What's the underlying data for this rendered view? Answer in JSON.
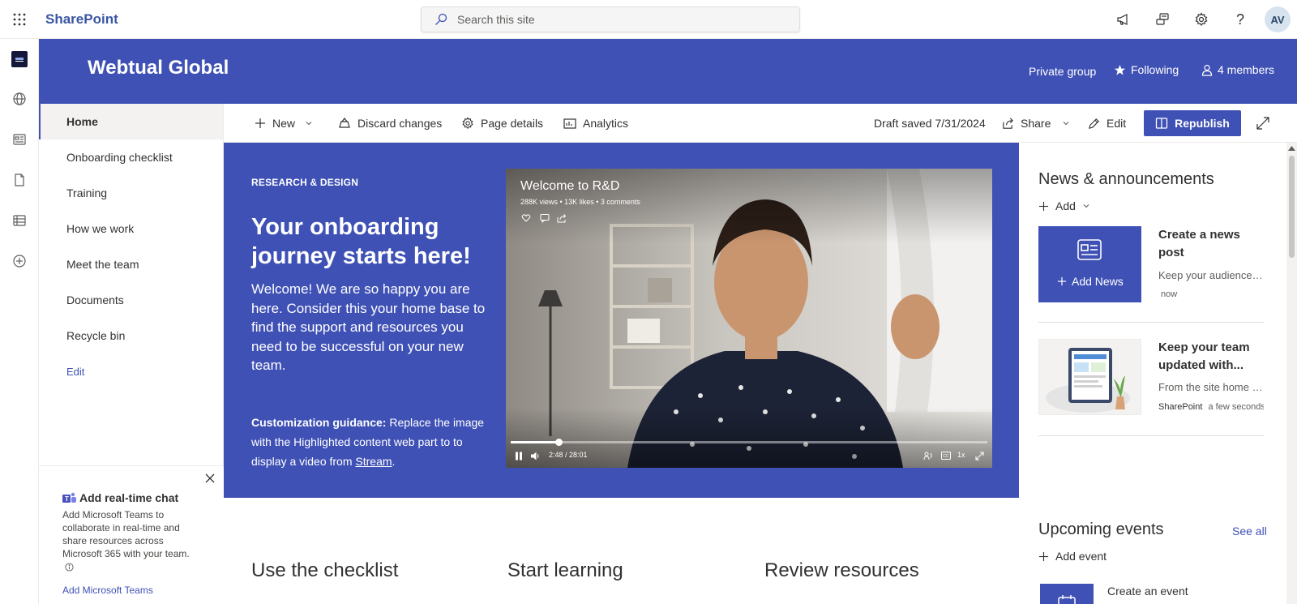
{
  "suite": {
    "brand": "SharePoint",
    "search_placeholder": "Search this site",
    "avatar_initials": "AV"
  },
  "site": {
    "title": "Webtual Global",
    "privacy": "Private group",
    "following": "Following",
    "members": "4 members"
  },
  "nav": {
    "items": [
      "Home",
      "Onboarding checklist",
      "Training",
      "How we work",
      "Meet the team",
      "Documents",
      "Recycle bin"
    ],
    "edit": "Edit"
  },
  "chat": {
    "title": "Add real-time chat",
    "body": "Add Microsoft Teams to collaborate in real-time and share resources across Microsoft 365 with your team.",
    "link": "Add Microsoft Teams"
  },
  "commandbar": {
    "new": "New",
    "discard": "Discard changes",
    "page_details": "Page details",
    "analytics": "Analytics",
    "draft_status": "Draft saved 7/31/2024",
    "share": "Share",
    "edit": "Edit",
    "republish": "Republish"
  },
  "hero": {
    "eyebrow": "RESEARCH & DESIGN",
    "title": "Your onboarding journey starts here!",
    "body": "Welcome! We are so happy you are here. Consider this your home base to find the support and resources you need to be successful on your new team.",
    "guidance_label": "Customization guidance:",
    "guidance_text": " Replace the image with the Highlighted content web part to to display a video from ",
    "guidance_link": "Stream",
    "guidance_end": "."
  },
  "video": {
    "title": "Welcome to R&D",
    "stats": "288K views • 13K likes • 3 comments",
    "time": "2:48 / 28:01",
    "speed": "1x",
    "progress": 0.1
  },
  "sections": {
    "checklist": "Use the checklist",
    "learning": "Start learning",
    "resources": "Review resources"
  },
  "news": {
    "title": "News & announcements",
    "add": "Add",
    "tile_label": "Add News",
    "item1": {
      "headline": "Create a news post",
      "desc": "Keep your audience engaged",
      "meta": "now"
    },
    "item2": {
      "headline": "Keep your team updated with...",
      "desc": "From the site home page",
      "author": "SharePoint",
      "time": "a few seconds ago"
    }
  },
  "events": {
    "title": "Upcoming events",
    "see_all": "See all",
    "add": "Add event",
    "item": "Create an event"
  },
  "colors": {
    "accent": "#3f51b5",
    "brand_text": "#3955a3"
  }
}
